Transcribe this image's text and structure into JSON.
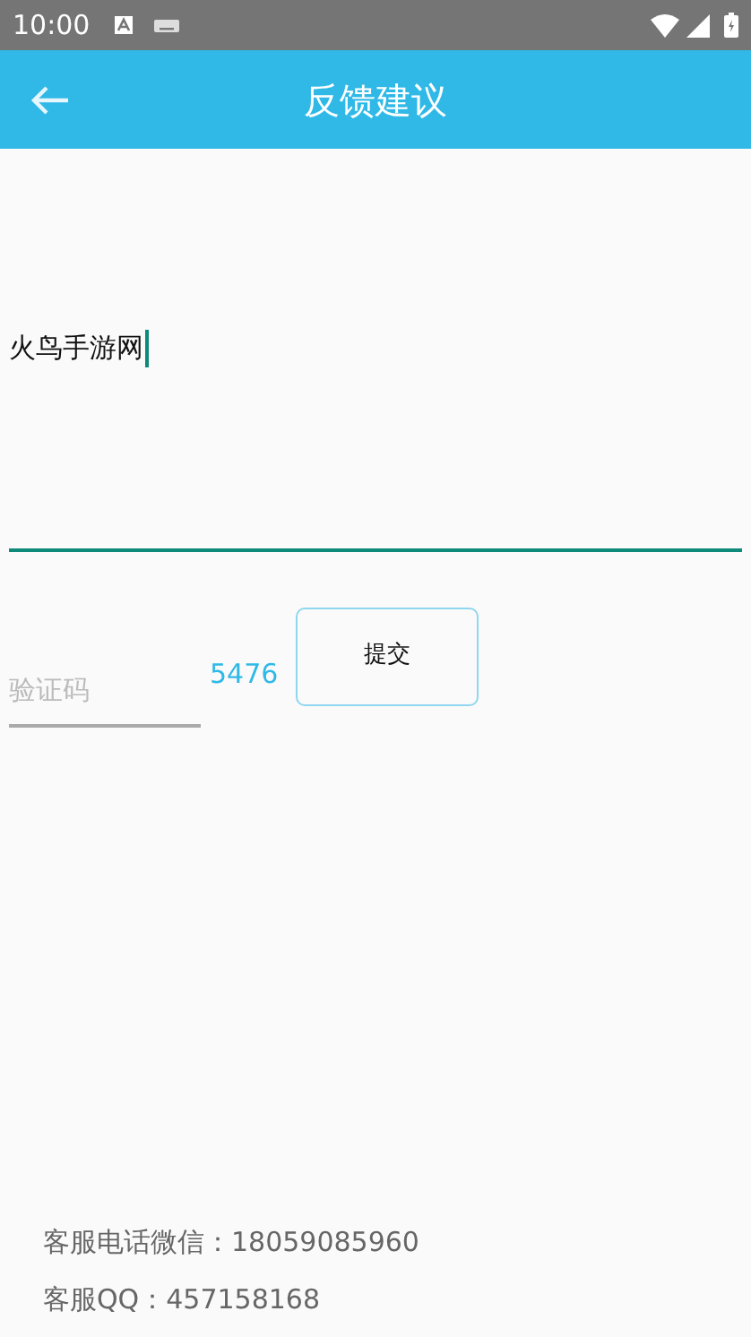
{
  "status_bar": {
    "time": "10:00"
  },
  "app_bar": {
    "title": "反馈建议"
  },
  "feedback": {
    "value": "火鸟手游网",
    "focused": true
  },
  "captcha": {
    "placeholder": "验证码",
    "code": "5476"
  },
  "submit_button": {
    "label": "提交"
  },
  "contacts": [
    "客服电话微信：18059085960",
    "客服QQ：457158168"
  ]
}
